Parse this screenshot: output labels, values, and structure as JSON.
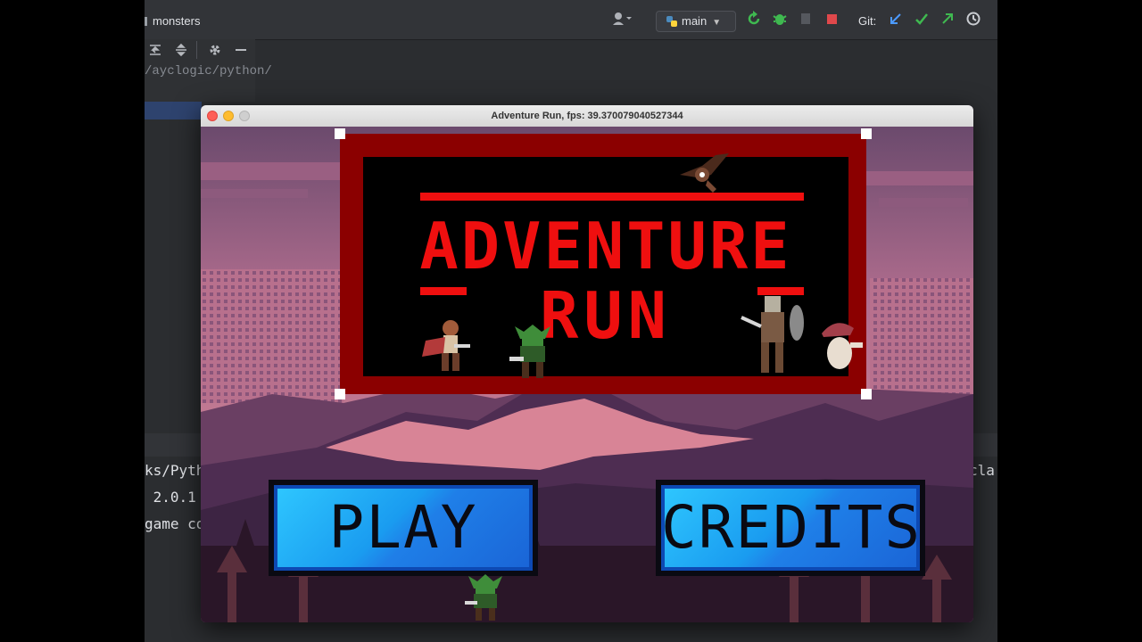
{
  "ide": {
    "project": "monsters",
    "branch": "main",
    "git_label": "Git:",
    "path": "/ayclogic/python/",
    "terminal_lines": [
      "ks/Pyth",
      " 2.0.1",
      "game co"
    ],
    "terminal_right": "cla"
  },
  "window": {
    "title": "Adventure Run, fps: 39.370079040527344"
  },
  "game": {
    "title_line1": "ADVENTURE",
    "title_line2": "RUN",
    "play_label": "PLAY",
    "credits_label": "CREDITS"
  },
  "colors": {
    "title_red": "#ef0f0f",
    "board_frame": "#8b0000",
    "button_blue": "#1a9cf0"
  }
}
